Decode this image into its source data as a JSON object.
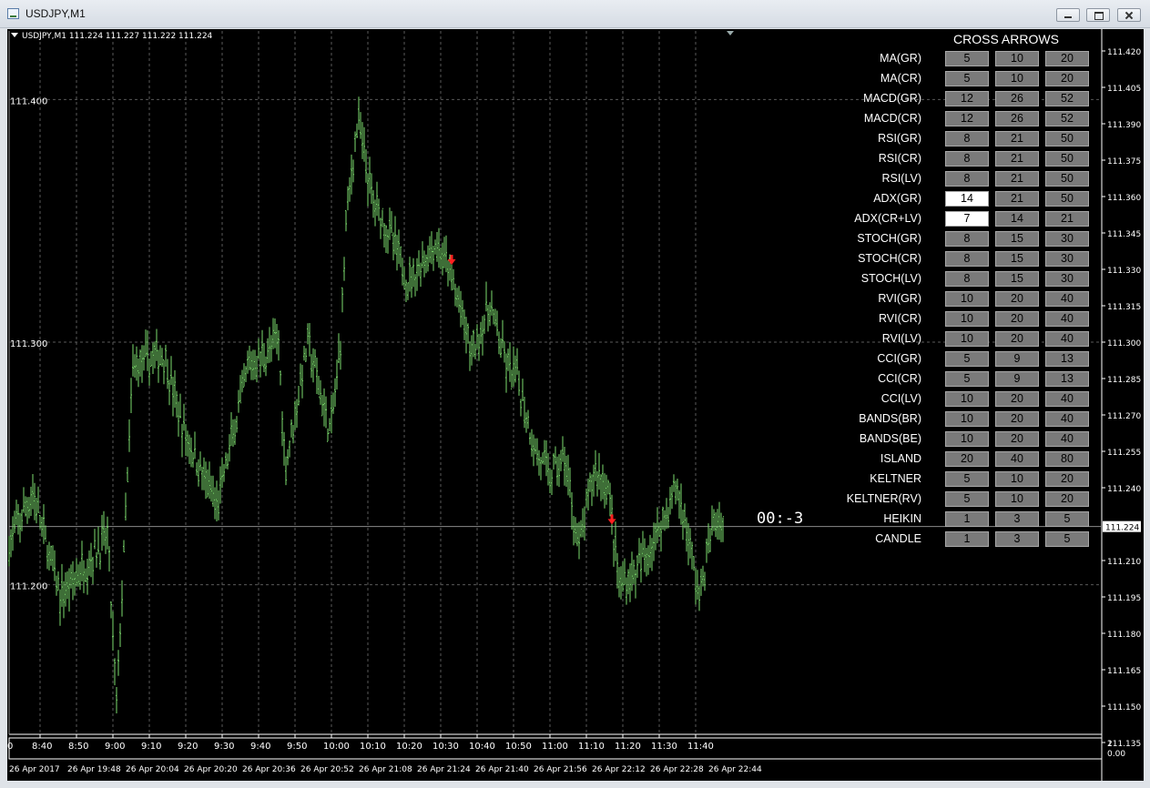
{
  "window": {
    "title": "USDJPY,M1"
  },
  "chart": {
    "symbol_line": "USDJPY,M1  111.224 111.227 111.222 111.224",
    "bid": "111.224",
    "timer": "00:-3",
    "left_price_labels": [
      "111.400",
      "111.300",
      "111.200"
    ],
    "price_axis": [
      "111.420",
      "111.405",
      "111.390",
      "111.375",
      "111.360",
      "111.345",
      "111.330",
      "111.315",
      "111.300",
      "111.285",
      "111.270",
      "111.255",
      "111.240",
      "111.224",
      "111.210",
      "111.195",
      "111.180",
      "111.165",
      "111.150",
      "111.135"
    ],
    "time_top": [
      "8:40",
      "8:50",
      "9:00",
      "9:10",
      "9:20",
      "9:30",
      "9:40",
      "9:50",
      "10:00",
      "10:10",
      "10:20",
      "10:30",
      "10:40",
      "10:50",
      "11:00",
      "11:10",
      "11:20",
      "11:30",
      "11:40"
    ],
    "time_bottom": [
      "26 Apr 2017",
      "26 Apr 19:48",
      "26 Apr 20:04",
      "26 Apr 20:20",
      "26 Apr 20:36",
      "26 Apr 20:52",
      "26 Apr 21:08",
      "26 Apr 21:24",
      "26 Apr 21:40",
      "26 Apr 21:56",
      "26 Apr 22:12",
      "26 Apr 22:28",
      "26 Apr 22:44"
    ],
    "subwindow_scale": [
      "2",
      "0.00"
    ],
    "colors": {
      "bar": "#7ddc6e",
      "arrow": "#ff2020",
      "grid": "#5a5a5a",
      "axis": "#ffffff"
    }
  },
  "panel": {
    "title": "CROSS ARROWS",
    "rows": [
      {
        "label": "MA(GR)",
        "values": [
          "5",
          "10",
          "20"
        ]
      },
      {
        "label": "MA(CR)",
        "values": [
          "5",
          "10",
          "20"
        ]
      },
      {
        "label": "MACD(GR)",
        "values": [
          "12",
          "26",
          "52"
        ]
      },
      {
        "label": "MACD(CR)",
        "values": [
          "12",
          "26",
          "52"
        ]
      },
      {
        "label": "RSI(GR)",
        "values": [
          "8",
          "21",
          "50"
        ]
      },
      {
        "label": "RSI(CR)",
        "values": [
          "8",
          "21",
          "50"
        ]
      },
      {
        "label": "RSI(LV)",
        "values": [
          "8",
          "21",
          "50"
        ]
      },
      {
        "label": "ADX(GR)",
        "values": [
          "14",
          "21",
          "50"
        ],
        "active": 0
      },
      {
        "label": "ADX(CR+LV)",
        "values": [
          "7",
          "14",
          "21"
        ],
        "active": 0
      },
      {
        "label": "STOCH(GR)",
        "values": [
          "8",
          "15",
          "30"
        ]
      },
      {
        "label": "STOCH(CR)",
        "values": [
          "8",
          "15",
          "30"
        ]
      },
      {
        "label": "STOCH(LV)",
        "values": [
          "8",
          "15",
          "30"
        ]
      },
      {
        "label": "RVI(GR)",
        "values": [
          "10",
          "20",
          "40"
        ]
      },
      {
        "label": "RVI(CR)",
        "values": [
          "10",
          "20",
          "40"
        ]
      },
      {
        "label": "RVI(LV)",
        "values": [
          "10",
          "20",
          "40"
        ]
      },
      {
        "label": "CCI(GR)",
        "values": [
          "5",
          "9",
          "13"
        ]
      },
      {
        "label": "CCI(CR)",
        "values": [
          "5",
          "9",
          "13"
        ]
      },
      {
        "label": "CCI(LV)",
        "values": [
          "10",
          "20",
          "40"
        ]
      },
      {
        "label": "BANDS(BR)",
        "values": [
          "10",
          "20",
          "40"
        ]
      },
      {
        "label": "BANDS(BE)",
        "values": [
          "10",
          "20",
          "40"
        ]
      },
      {
        "label": "ISLAND",
        "values": [
          "20",
          "40",
          "80"
        ]
      },
      {
        "label": "KELTNER",
        "values": [
          "5",
          "10",
          "20"
        ]
      },
      {
        "label": "KELTNER(RV)",
        "values": [
          "5",
          "10",
          "20"
        ]
      },
      {
        "label": "HEIKIN",
        "values": [
          "1",
          "3",
          "5"
        ]
      },
      {
        "label": "CANDLE",
        "values": [
          "1",
          "3",
          "5"
        ]
      }
    ]
  }
}
